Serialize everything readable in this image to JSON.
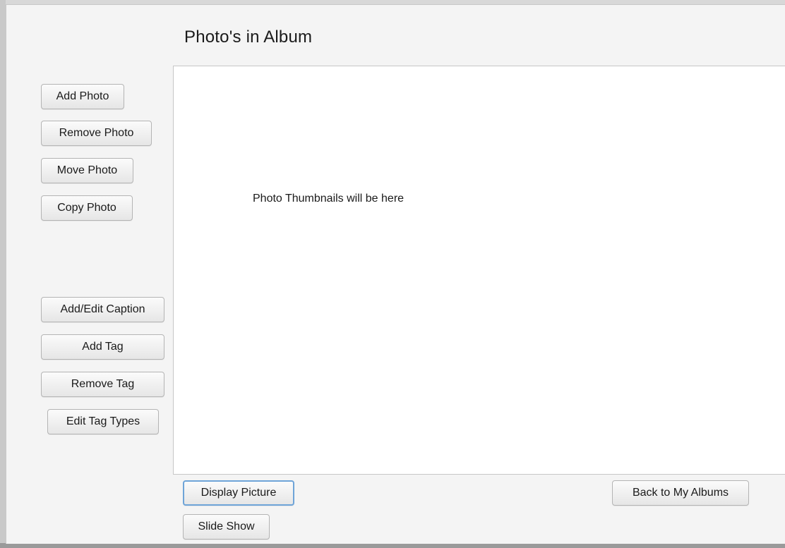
{
  "window": {
    "title": "Photo's in Album"
  },
  "sidebar": {
    "photo_actions": [
      {
        "label": "Add Photo"
      },
      {
        "label": "Remove Photo"
      },
      {
        "label": "Move Photo"
      },
      {
        "label": "Copy Photo"
      }
    ],
    "tag_actions": [
      {
        "label": "Add/Edit Caption"
      },
      {
        "label": "Add Tag"
      },
      {
        "label": "Remove Tag"
      },
      {
        "label": "Edit Tag Types"
      }
    ]
  },
  "main": {
    "placeholder_text": "Photo Thumbnails will be here"
  },
  "footer": {
    "display_picture_label": "Display Picture",
    "slide_show_label": "Slide Show",
    "back_label": "Back to My Albums"
  },
  "colors": {
    "focus_border": "#6ea4d8",
    "window_bg": "#f4f4f4",
    "canvas_bg": "#ffffff"
  }
}
